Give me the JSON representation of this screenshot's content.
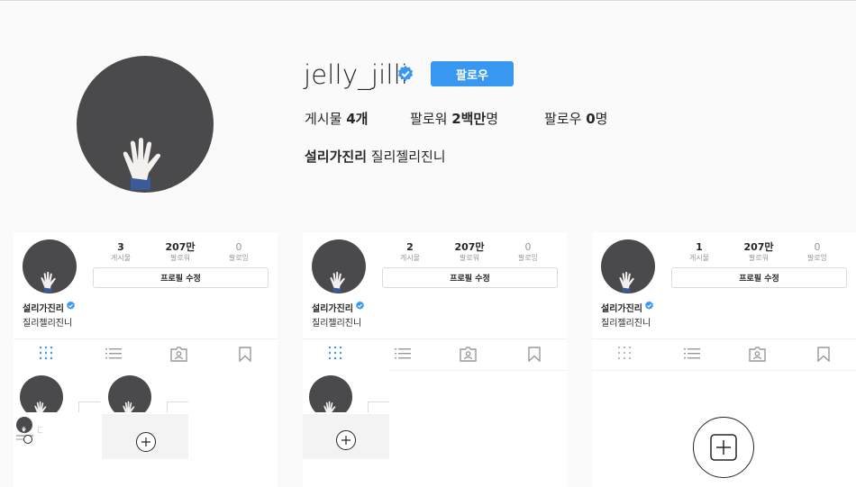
{
  "profile": {
    "username": "jelly_jilli",
    "follow_label": "팔로우",
    "posts_label": "게시물",
    "posts_count": "4개",
    "followers_label": "팔로워",
    "followers_count": "2백만",
    "followers_unit": "명",
    "following_label": "팔로우",
    "following_count": "0",
    "following_unit": "명",
    "full_name": "설리가진리",
    "bio": "질리젤리진니"
  },
  "panels": [
    {
      "posts": "3",
      "followers": "207만",
      "following": "0"
    },
    {
      "posts": "2",
      "followers": "207만",
      "following": "0"
    },
    {
      "posts": "1",
      "followers": "207만",
      "following": "0"
    }
  ],
  "panel_common": {
    "posts_label": "게시물",
    "followers_label": "팔로워",
    "following_label": "팔로잉",
    "edit_label": "프로필 수정",
    "name": "설리가진리",
    "bio": "질리젤리진니"
  },
  "icons": [
    "verified-badge-icon",
    "grid-icon",
    "list-icon",
    "tagged-icon",
    "bookmark-icon",
    "add-icon"
  ],
  "colors": {
    "accent": "#3897f0",
    "background": "#fafafa",
    "avatar": "#4a4a4c"
  }
}
